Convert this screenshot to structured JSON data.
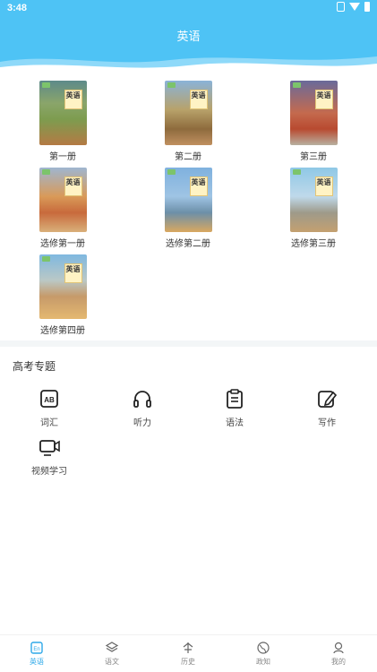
{
  "status_bar": {
    "time": "3:48"
  },
  "header": {
    "title": "英语"
  },
  "books": [
    {
      "label": "第一册",
      "cover_text": "英语"
    },
    {
      "label": "第二册",
      "cover_text": "英语"
    },
    {
      "label": "第三册",
      "cover_text": "英语"
    },
    {
      "label": "选修第一册",
      "cover_text": "英语"
    },
    {
      "label": "选修第二册",
      "cover_text": "英语"
    },
    {
      "label": "选修第三册",
      "cover_text": "英语"
    },
    {
      "label": "选修第四册",
      "cover_text": "英语"
    }
  ],
  "gaokao": {
    "title": "高考专题",
    "topics": [
      {
        "label": "词汇",
        "icon": "vocabulary-icon"
      },
      {
        "label": "听力",
        "icon": "headphones-icon"
      },
      {
        "label": "语法",
        "icon": "clipboard-icon"
      },
      {
        "label": "写作",
        "icon": "edit-icon"
      },
      {
        "label": "视频学习",
        "icon": "video-icon"
      }
    ]
  },
  "tabbar": {
    "active_color": "#2ea8e8",
    "tabs": [
      {
        "label": "英语",
        "icon": "english-icon",
        "active": true
      },
      {
        "label": "语文",
        "icon": "layers-icon",
        "active": false
      },
      {
        "label": "历史",
        "icon": "history-icon",
        "active": false
      },
      {
        "label": "政知",
        "icon": "globe-icon",
        "active": false
      },
      {
        "label": "我的",
        "icon": "user-icon",
        "active": false
      }
    ]
  },
  "colors": {
    "header_bg": "#4ec3f5"
  }
}
